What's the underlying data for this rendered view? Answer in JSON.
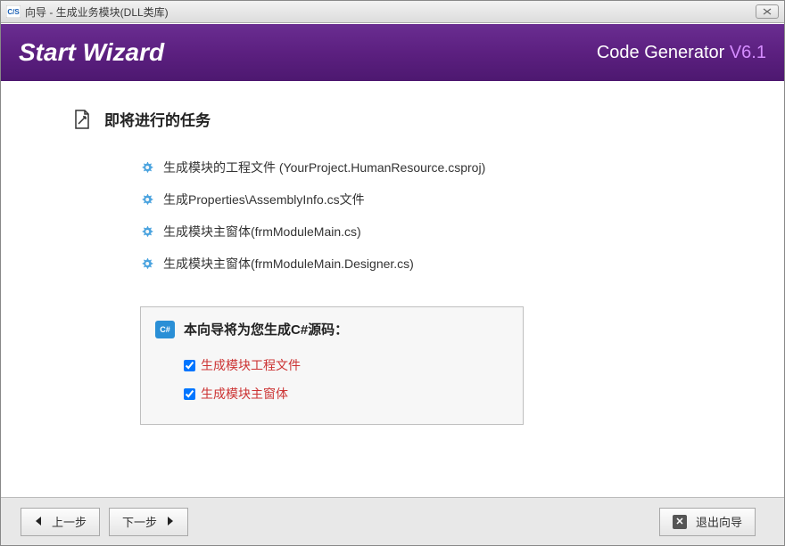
{
  "window": {
    "title": "向导 - 生成业务模块(DLL类库)"
  },
  "banner": {
    "title": "Start Wizard",
    "product": "Code Generator ",
    "version": "V6.1"
  },
  "section": {
    "heading": "即将进行的任务"
  },
  "tasks": [
    {
      "text": "生成模块的工程文件 (YourProject.HumanResource.csproj)"
    },
    {
      "text": "生成Properties\\AssemblyInfo.cs文件"
    },
    {
      "text": "生成模块主窗体(frmModuleMain.cs)"
    },
    {
      "text": "生成模块主窗体(frmModuleMain.Designer.cs)"
    }
  ],
  "infobox": {
    "icon_label": "C#",
    "title": "本向导将为您生成C#源码：",
    "checks": [
      {
        "label": "生成模块工程文件",
        "checked": true
      },
      {
        "label": "生成模块主窗体",
        "checked": true
      }
    ]
  },
  "footer": {
    "prev": "上一步",
    "next": "下一步",
    "exit": "退出向导"
  }
}
